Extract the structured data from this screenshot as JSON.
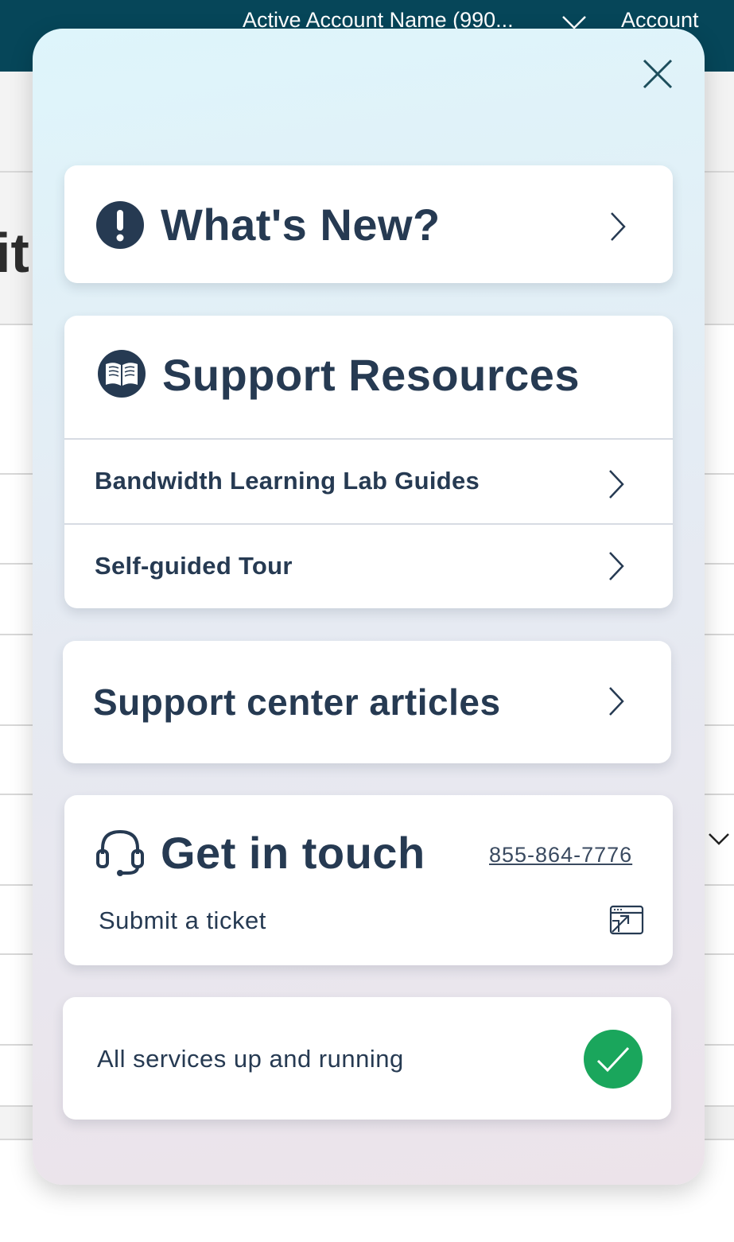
{
  "header": {
    "account_selector": "Active Account Name (990...",
    "account_link": "Account"
  },
  "background": {
    "heading_fragment": "it"
  },
  "help_panel": {
    "whats_new": {
      "label": "What's New?"
    },
    "support_resources": {
      "title": "Support Resources",
      "items": [
        {
          "label": "Bandwidth Learning Lab Guides"
        },
        {
          "label": "Self-guided Tour"
        }
      ]
    },
    "support_center": {
      "label": "Support center articles"
    },
    "get_in_touch": {
      "title": "Get in touch",
      "phone": "855-864-7776",
      "ticket_label": "Submit a ticket"
    },
    "status": {
      "label": "All services up and running",
      "color": "#1aa65c"
    }
  },
  "colors": {
    "header_bg": "#064659",
    "text_primary": "#263a52",
    "status_ok": "#1aa65c"
  }
}
